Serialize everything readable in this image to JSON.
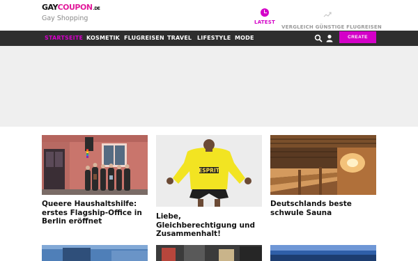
{
  "header": {
    "logo_main": "GAYCOUPON",
    "logo_tld": ".DE",
    "logo_sub": "Gay Shopping",
    "latest_label": "LATEST",
    "trending_label": "VERGLEICH GÜNSTIGE FLUGREISEN"
  },
  "nav": {
    "items": [
      {
        "label": "STARTSEITE",
        "active": true
      },
      {
        "label": "KOSMETIK",
        "active": false
      },
      {
        "label": "FLUGREISEN",
        "active": false
      },
      {
        "label": "TRAVEL",
        "active": false
      },
      {
        "label": "LIFESTYLE",
        "active": false
      },
      {
        "label": "MODE",
        "active": false
      }
    ],
    "search_icon": "search-icon",
    "user_icon": "user-icon",
    "create_label": "CREATE"
  },
  "colors": {
    "accent": "#d400c8",
    "nav_bg": "#2e2e2e",
    "banner_bg": "#efefef"
  },
  "articles": [
    {
      "title": "Queere Haushaltshilfe: erstes Flagship-Office in Berlin eröffnet",
      "image": "people in front of pink building"
    },
    {
      "title": "Liebe, Gleichberechtigung und Zusammenhalt!",
      "image": "man in yellow Esprit sweater"
    },
    {
      "title": "Deutschlands beste schwule Sauna",
      "image": "wooden sauna interior"
    }
  ],
  "image_texts": {
    "sweater_brand": "ESPRIT"
  }
}
